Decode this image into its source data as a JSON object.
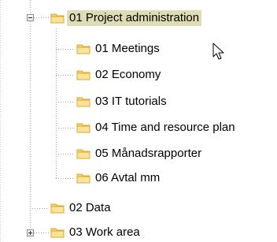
{
  "tree": {
    "root": {
      "label": "01 Project administration",
      "expanded": true,
      "selected": true,
      "children": [
        {
          "label": "01 Meetings"
        },
        {
          "label": "02 Economy"
        },
        {
          "label": "03 IT tutorials"
        },
        {
          "label": "04 Time and resource plan"
        },
        {
          "label": "05 Månadsrapporter"
        },
        {
          "label": "06 Avtal mm"
        }
      ]
    },
    "siblings": [
      {
        "label": "02 Data",
        "expandable": false
      },
      {
        "label": "03 Work area",
        "expandable": true,
        "expanded": false
      }
    ]
  },
  "colors": {
    "selection": "#dddcb4",
    "folder_fill": "#f6d36b",
    "folder_dark": "#d9a82f",
    "guide": "#a0a0a0"
  },
  "icons": {
    "folder": "folder-icon",
    "cursor": "mouse-pointer-icon"
  }
}
